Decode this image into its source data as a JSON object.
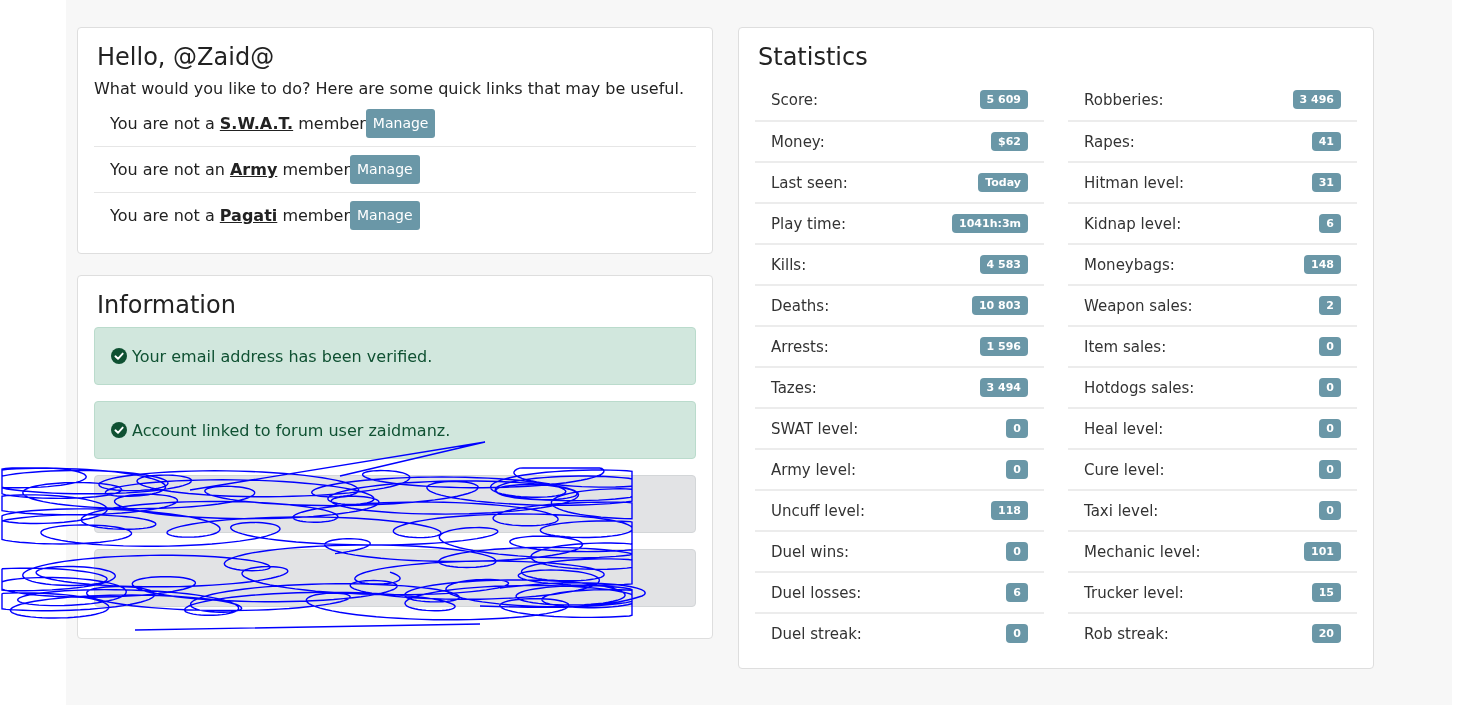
{
  "greeting_card": {
    "title": "Hello, @Zaid@",
    "intro": "What would you like to do? Here are some quick links that may be useful.",
    "memberships": [
      {
        "prefix": "You are not a",
        "group": "S.W.A.T.",
        "suffix": "member",
        "button": "Manage"
      },
      {
        "prefix": "You are not an",
        "group": "Army",
        "suffix": "member",
        "button": "Manage"
      },
      {
        "prefix": "You are not a",
        "group": "Pagati",
        "suffix": "member",
        "button": "Manage"
      }
    ]
  },
  "information": {
    "title": "Information",
    "alerts": [
      {
        "kind": "success",
        "text": "Your email address has been verified."
      },
      {
        "kind": "success",
        "text": "Account linked to forum user zaidmanz."
      },
      {
        "kind": "secondary"
      },
      {
        "kind": "secondary"
      }
    ]
  },
  "statistics": {
    "title": "Statistics",
    "columns": [
      {
        "items": [
          {
            "label": "Score:",
            "value": "5 609"
          },
          {
            "label": "Money:",
            "value": "$62"
          },
          {
            "label": "Last seen:",
            "value": "Today"
          },
          {
            "label": "Play time:",
            "value": "1041h:3m"
          },
          {
            "label": "Kills:",
            "value": "4 583"
          },
          {
            "label": "Deaths:",
            "value": "10 803"
          },
          {
            "label": "Arrests:",
            "value": "1 596"
          },
          {
            "label": "Tazes:",
            "value": "3 494"
          },
          {
            "label": "SWAT level:",
            "value": "0"
          },
          {
            "label": "Army level:",
            "value": "0"
          },
          {
            "label": "Uncuff level:",
            "value": "118"
          },
          {
            "label": "Duel wins:",
            "value": "0"
          },
          {
            "label": "Duel losses:",
            "value": "6"
          },
          {
            "label": "Duel streak:",
            "value": "0"
          }
        ]
      },
      {
        "items": [
          {
            "label": "Robberies:",
            "value": "3 496"
          },
          {
            "label": "Rapes:",
            "value": "41"
          },
          {
            "label": "Hitman level:",
            "value": "31"
          },
          {
            "label": "Kidnap level:",
            "value": "6"
          },
          {
            "label": "Moneybags:",
            "value": "148"
          },
          {
            "label": "Weapon sales:",
            "value": "2"
          },
          {
            "label": "Item sales:",
            "value": "0"
          },
          {
            "label": "Hotdogs sales:",
            "value": "0"
          },
          {
            "label": "Heal level:",
            "value": "0"
          },
          {
            "label": "Cure level:",
            "value": "0"
          },
          {
            "label": "Taxi level:",
            "value": "0"
          },
          {
            "label": "Mechanic level:",
            "value": "101"
          },
          {
            "label": "Trucker level:",
            "value": "15"
          },
          {
            "label": "Rob streak:",
            "value": "20"
          }
        ]
      }
    ]
  }
}
